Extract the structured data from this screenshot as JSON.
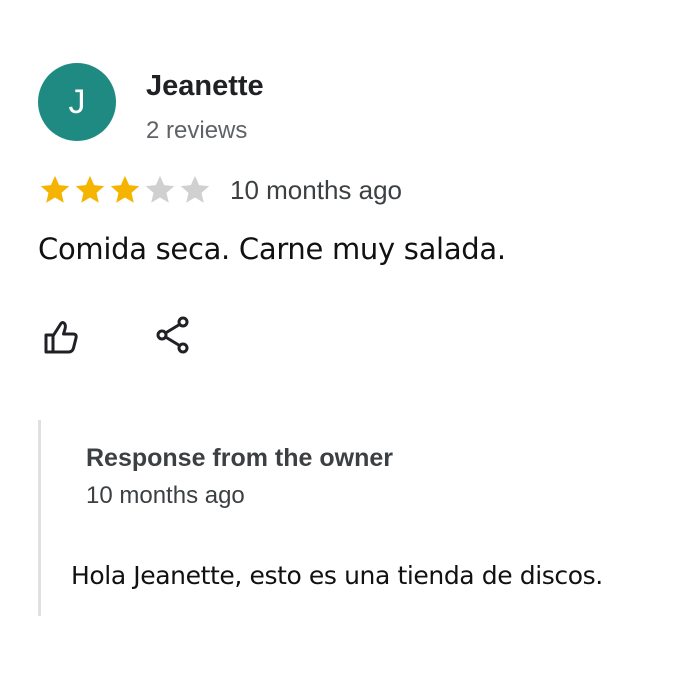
{
  "review": {
    "avatar_initial": "J",
    "reviewer_name": "Jeanette",
    "reviewer_reviews": "2 reviews",
    "rating": 3,
    "rating_max": 5,
    "time_ago": "10 months ago",
    "text": "Comida seca. Carne muy salada."
  },
  "actions": {
    "like_icon": "thumbs-up-icon",
    "share_icon": "share-icon"
  },
  "owner_response": {
    "title": "Response from the owner",
    "time_ago": "10 months ago",
    "text": "Hola Jeanette, esto es una tienda de discos."
  },
  "colors": {
    "avatar_bg": "#1f8a82",
    "star_filled": "#f5b400",
    "star_empty": "#d0d0d0"
  }
}
